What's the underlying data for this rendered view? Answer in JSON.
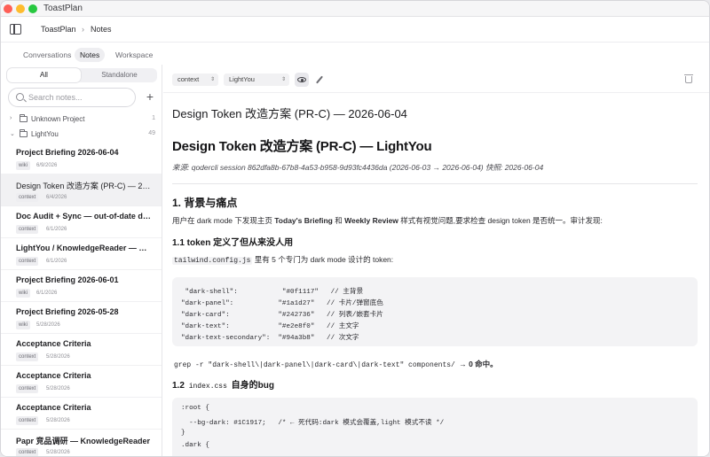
{
  "app": {
    "title": "ToastPlan"
  },
  "breadcrumb": {
    "workspace": "ToastPlan",
    "section": "Notes"
  },
  "nav_tabs": [
    {
      "label": "Conversations"
    },
    {
      "label": "Notes"
    },
    {
      "label": "Workspace"
    }
  ],
  "sidebar": {
    "segments": [
      "All",
      "Standalone"
    ],
    "search_placeholder": "Search notes...",
    "add_label": "+",
    "folders": [
      {
        "name": "Unknown Project",
        "count": "1",
        "chevron": "›"
      },
      {
        "name": "LightYou",
        "count": "49",
        "chevron": "⌄"
      }
    ],
    "notes": [
      {
        "title": "Project Briefing 2026-06-04",
        "tag": "wiki",
        "date": "6/9/2026"
      },
      {
        "title": "Design Token 改造方案 (PR-C) — 2026-06-04",
        "tag": "context",
        "date": "6/4/2026"
      },
      {
        "title": "Doc Audit + Sync — out-of-date docs",
        "tag": "context",
        "date": "6/1/2026"
      },
      {
        "title": "LightYou / KnowledgeReader — Product",
        "tag": "context",
        "date": "6/1/2026"
      },
      {
        "title": "Project Briefing 2026-06-01",
        "tag": "wiki",
        "date": "6/1/2026"
      },
      {
        "title": "Project Briefing 2026-05-28",
        "tag": "wiki",
        "date": "5/28/2026"
      },
      {
        "title": "Acceptance Criteria",
        "tag": "context",
        "date": "5/28/2026"
      },
      {
        "title": "Acceptance Criteria",
        "tag": "context",
        "date": "5/28/2026"
      },
      {
        "title": "Acceptance Criteria",
        "tag": "context",
        "date": "5/28/2026"
      },
      {
        "title": "Papr 竞品调研 — KnowledgeReader",
        "tag": "context",
        "date": "5/28/2026"
      }
    ]
  },
  "toolbar": {
    "type_select": "context",
    "project_select": "LightYou"
  },
  "doc": {
    "title": "Design Token 改造方案 (PR-C) — 2026-06-04",
    "h1": "Design Token 改造方案 (PR-C) — LightYou",
    "source": "来源: qodercli session 862dfa8b-67b8-4a53-b958-9d93fc4436da (2026-06-03 → 2026-06-04) 快照: 2026-06-04",
    "s1_heading": "1. 背景与痛点",
    "s1_p1_a": "用户在 dark mode 下发现主页 ",
    "s1_p1_b1": "Today's Briefing",
    "s1_p1_c": " 和 ",
    "s1_p1_b2": "Weekly Review",
    "s1_p1_d": " 样式有视觉问题,要求检查 design token 是否统一。审计发现:",
    "s11_heading": "1.1 token 定义了但从来没人用",
    "s11_code": "tailwind.config.js",
    "s11_text": " 里有 5 个专门为 dark mode 设计的 token:",
    "code1": [
      " \"dark-shell\":           \"#0f1117\"   // 主背景",
      "\"dark-panel\":           \"#1a1d27\"   // 卡片/弹窗底色",
      "\"dark-card\":            \"#242736\"   // 列表/嵌套卡片",
      "\"dark-text\":            \"#e2e8f0\"   // 主文字",
      "\"dark-text-secondary\":  \"#94a3b8\"   // 次文字"
    ],
    "grep_code": "grep -r \"dark-shell\\|dark-panel\\|dark-card\\|dark-text\" components/",
    "grep_result": " → 0 命中。",
    "s12_num": "1.2 ",
    "s12_code": "index.css",
    "s12_text": " 自身的bug",
    "code2": [
      ":root {",
      "  --bg-dark: #1C1917;   /* ← 死代码:dark 模式会覆盖,light 模式不读 */",
      "}",
      ".dark {"
    ]
  }
}
